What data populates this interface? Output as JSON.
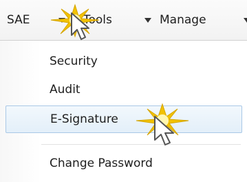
{
  "menubar": {
    "items": [
      {
        "label": "SAE"
      },
      {
        "label": "Tools"
      },
      {
        "label": "Manage"
      }
    ]
  },
  "menu": {
    "items": [
      {
        "label": "Security"
      },
      {
        "label": "Audit"
      },
      {
        "label": "E-Signature"
      },
      {
        "label": "Change Password"
      }
    ]
  },
  "colors": {
    "highlight_bg": "#e3eff9",
    "highlight_border": "#a9c8e6",
    "sparkle": "#f2c200"
  }
}
